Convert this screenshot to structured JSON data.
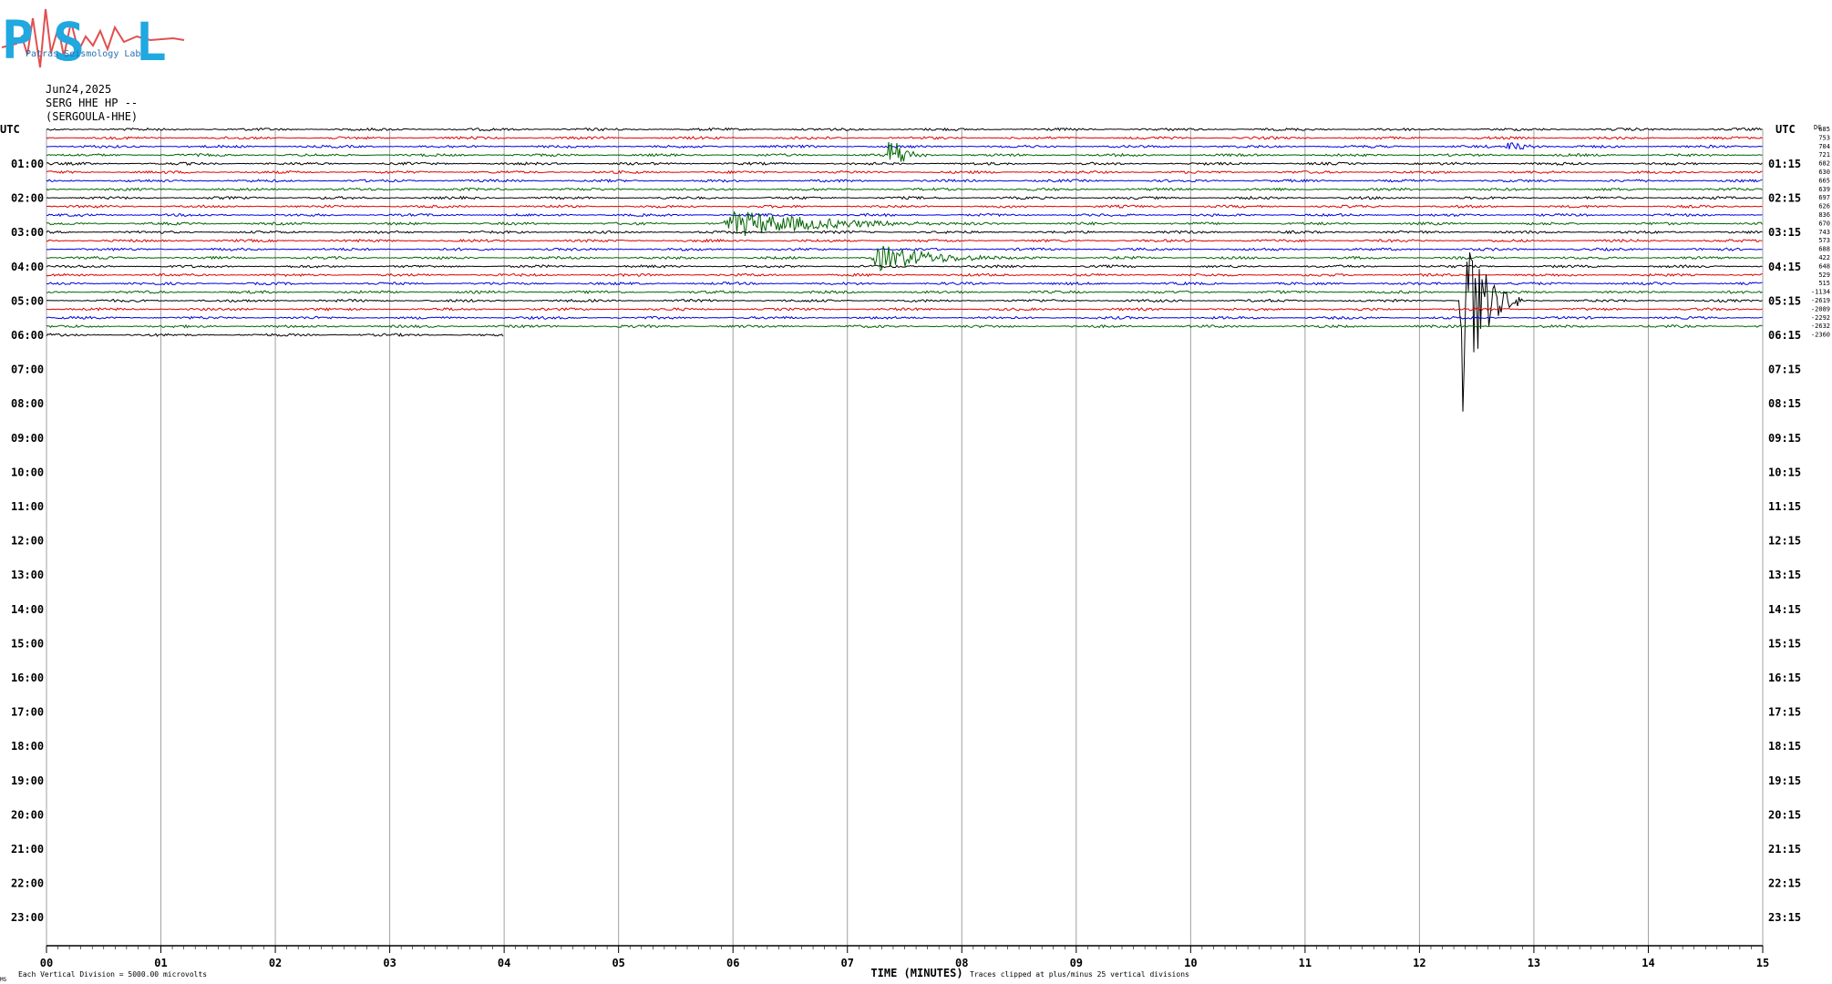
{
  "header": {
    "date": "Jun24,2025",
    "station": "SERG HHE HP --",
    "location": "(SERGOULA-HHE)"
  },
  "logo": {
    "letters": [
      "P",
      "S",
      "L"
    ],
    "text": "Patras Seismology Lab"
  },
  "chart_data": {
    "type": "line",
    "title": "",
    "xlabel": "TIME (MINUTES)",
    "ylabel_left": "UTC",
    "ylabel_right": "UTC",
    "x_ticks": [
      "00",
      "01",
      "02",
      "03",
      "04",
      "05",
      "06",
      "07",
      "08",
      "09",
      "10",
      "11",
      "12",
      "13",
      "14",
      "15"
    ],
    "xlim": [
      0,
      15
    ],
    "row_minutes": 15,
    "left_hour_labels": [
      "01:00",
      "02:00",
      "03:00",
      "04:00",
      "05:00",
      "06:00",
      "07:00",
      "08:00",
      "09:00",
      "10:00",
      "11:00",
      "12:00",
      "13:00",
      "14:00",
      "15:00",
      "16:00",
      "17:00",
      "18:00",
      "19:00",
      "20:00",
      "21:00",
      "22:00",
      "23:00"
    ],
    "right_hour_labels": [
      "01:15",
      "02:15",
      "03:15",
      "04:15",
      "05:15",
      "06:15",
      "07:15",
      "08:15",
      "09:15",
      "10:15",
      "11:15",
      "12:15",
      "13:15",
      "14:15",
      "15:15",
      "16:15",
      "17:15",
      "18:15",
      "19:15",
      "20:15",
      "21:15",
      "22:15",
      "23:15"
    ],
    "trace_colors": [
      "#000000",
      "#e00000",
      "#0000e0",
      "#006400"
    ],
    "row_dc_offsets": [
      "685",
      "753",
      "704",
      "721",
      "682",
      "630",
      "665",
      "639",
      "697",
      "626",
      "836",
      "670",
      "743",
      "573",
      "688",
      "422",
      "648",
      "529",
      "515",
      "-1134",
      "-2619",
      "-2089",
      "-2292",
      "-2632",
      "-2360"
    ],
    "dc_label": "DC",
    "footer_left": "Each Vertical Division = 5000.00 microvolts",
    "footer_right": "Traces clipped at plus/minus 25 vertical divisions",
    "footer_mark": "MS",
    "events": [
      {
        "row": 3,
        "minute_start": 7.35,
        "minute_end": 7.75,
        "amplitude": "large",
        "note": "clipped spike"
      },
      {
        "row": 11,
        "minute_start": 5.9,
        "minute_end": 8.6,
        "amplitude": "medium"
      },
      {
        "row": 15,
        "minute_start": 7.2,
        "minute_end": 8.9,
        "amplitude": "medium"
      },
      {
        "row": 20,
        "minute_start": 12.35,
        "minute_end": 12.9,
        "amplitude": "clipped"
      },
      {
        "row": 2,
        "minute_start": 12.75,
        "minute_end": 13.35,
        "amplitude": "small"
      }
    ],
    "data_end": {
      "row": 24,
      "minute": 4.0
    }
  }
}
